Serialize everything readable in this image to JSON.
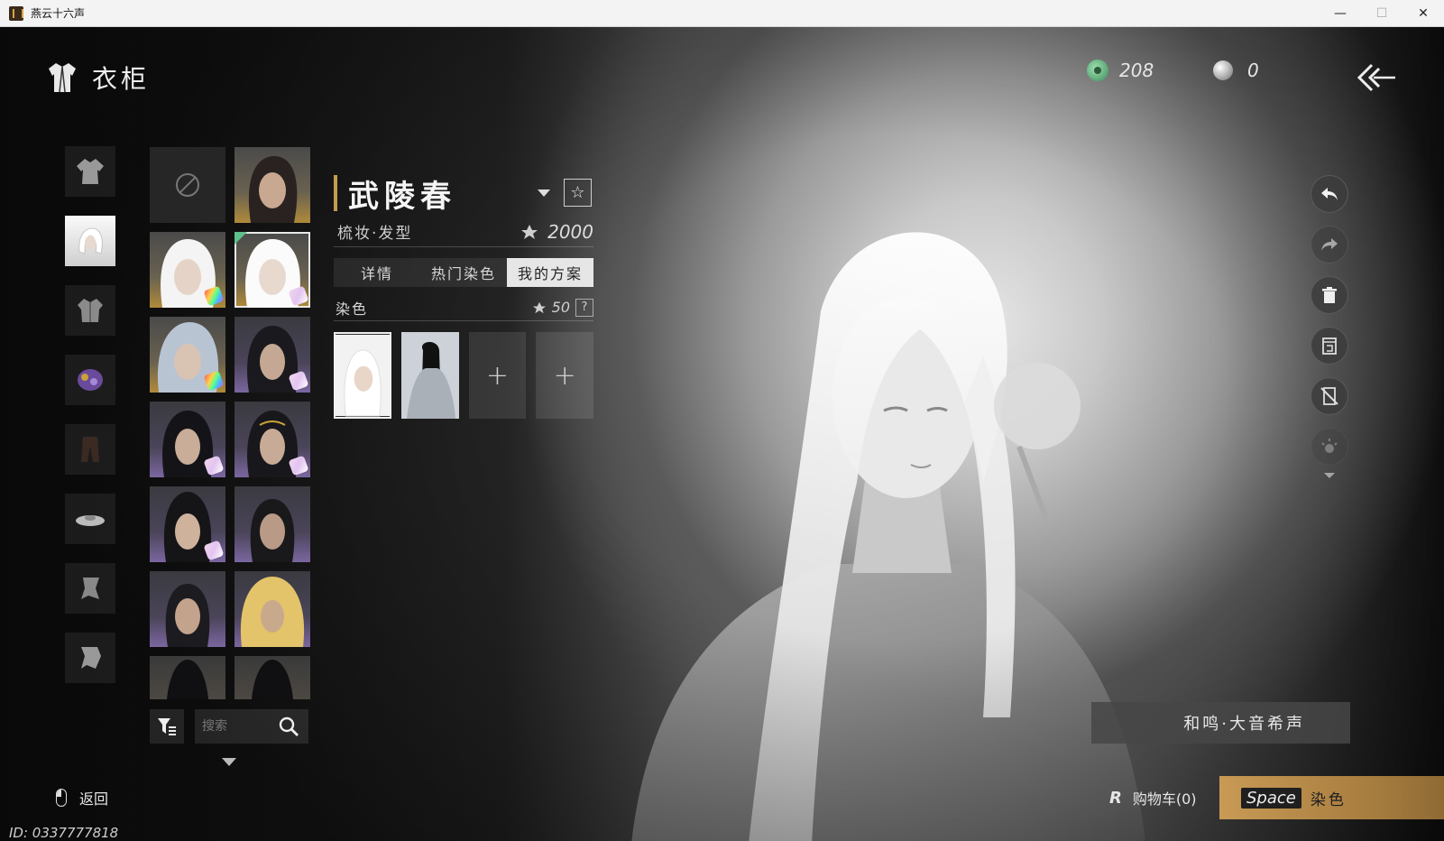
{
  "window": {
    "title": "燕云十六声",
    "minimize": "—",
    "maximize": "☐",
    "close": "✕"
  },
  "header": {
    "title": "衣柜",
    "jade_amount": "208",
    "pearl_amount": "0"
  },
  "categories": [
    {
      "id": "robe",
      "icon": "robe-icon",
      "active": false
    },
    {
      "id": "hair",
      "icon": "hair-portrait-icon",
      "active": true
    },
    {
      "id": "top",
      "icon": "jacket-icon",
      "active": false
    },
    {
      "id": "accessory",
      "icon": "ornament-icon",
      "active": false
    },
    {
      "id": "pants",
      "icon": "trousers-icon",
      "active": false
    },
    {
      "id": "hat",
      "icon": "hat-icon",
      "active": false
    },
    {
      "id": "cape",
      "icon": "cape-icon",
      "active": false
    },
    {
      "id": "cape2",
      "icon": "cape-alt-icon",
      "active": false
    }
  ],
  "search": {
    "placeholder": "搜索"
  },
  "item": {
    "name": "武陵春",
    "category": "梳妆·发型",
    "price": "2000",
    "favorite_icon": "☆"
  },
  "tabs": [
    {
      "label": "详情",
      "active": false
    },
    {
      "label": "热门染色",
      "active": false
    },
    {
      "label": "我的方案",
      "active": true
    }
  ],
  "dye": {
    "label": "染色",
    "cost": "50",
    "help": "?",
    "add_symbol": "+"
  },
  "outfit": {
    "name": "和鸣·大音希声"
  },
  "footer": {
    "back_label": "返回",
    "user_id": "ID: 0337777818",
    "cart_key": "R",
    "cart_label": "购物车(0)",
    "action_key": "Space",
    "action_label": "染色"
  },
  "colors": {
    "accent_gold": "#c69b52",
    "selected_green": "#5ec08a"
  }
}
